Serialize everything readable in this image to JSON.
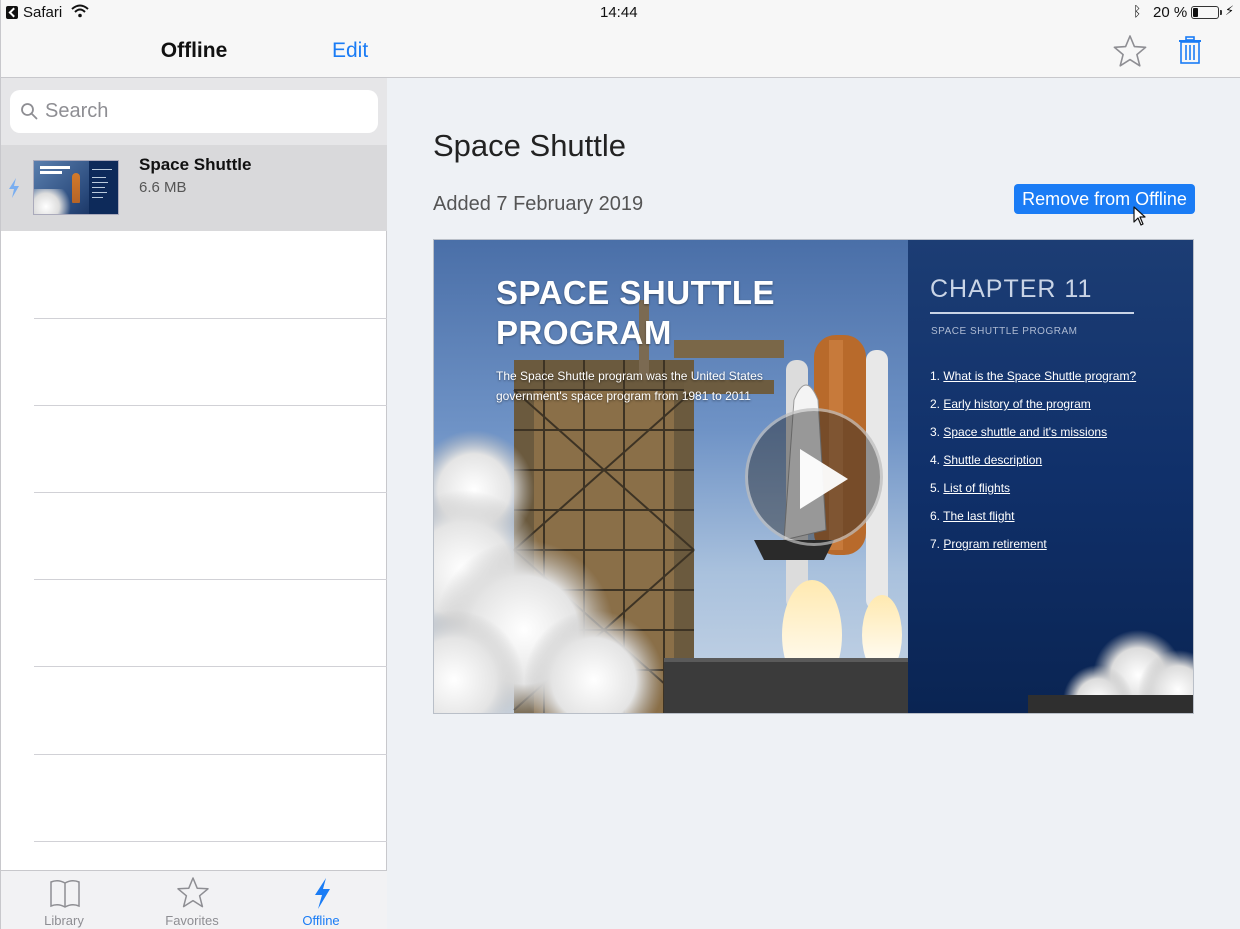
{
  "status": {
    "app_name": "Safari",
    "time": "14:44",
    "battery_percent": "20 %",
    "battery_level": 0.2
  },
  "sidebar": {
    "title": "Offline",
    "edit_label": "Edit",
    "search_placeholder": "Search",
    "items": [
      {
        "name": "Space Shuttle",
        "size": "6.6 MB"
      }
    ]
  },
  "tabs": [
    {
      "label": "Library",
      "icon": "book-icon",
      "active": false
    },
    {
      "label": "Favorites",
      "icon": "star-icon",
      "active": false
    },
    {
      "label": "Offline",
      "icon": "bolt-icon",
      "active": true
    }
  ],
  "detail": {
    "title": "Space Shuttle",
    "added": "Added 7 February 2019",
    "remove_label": "Remove from Offline",
    "preview": {
      "title_line1": "SPACE SHUTTLE",
      "title_line2": "PROGRAM",
      "desc_line1": "The Space Shuttle program was the United States",
      "desc_line2": "government's space program from 1981 to 2011",
      "chapter": "CHAPTER 11",
      "chapter_sub": "SPACE SHUTTLE PROGRAM",
      "toc": [
        {
          "num": "1.",
          "text": "What is the Space Shuttle program?"
        },
        {
          "num": "2.",
          "text": "Early history of the program"
        },
        {
          "num": "3.",
          "text": "Space shuttle and it's missions"
        },
        {
          "num": "4.",
          "text": "Shuttle description"
        },
        {
          "num": "5.",
          "text": "List of flights"
        },
        {
          "num": "6.",
          "text": "The last flight"
        },
        {
          "num": "7.",
          "text": "Program retirement"
        }
      ]
    }
  },
  "colors": {
    "accent": "#1a7cf5",
    "selected_row": "#d9d9db",
    "pane_bg": "#eef1f5"
  }
}
